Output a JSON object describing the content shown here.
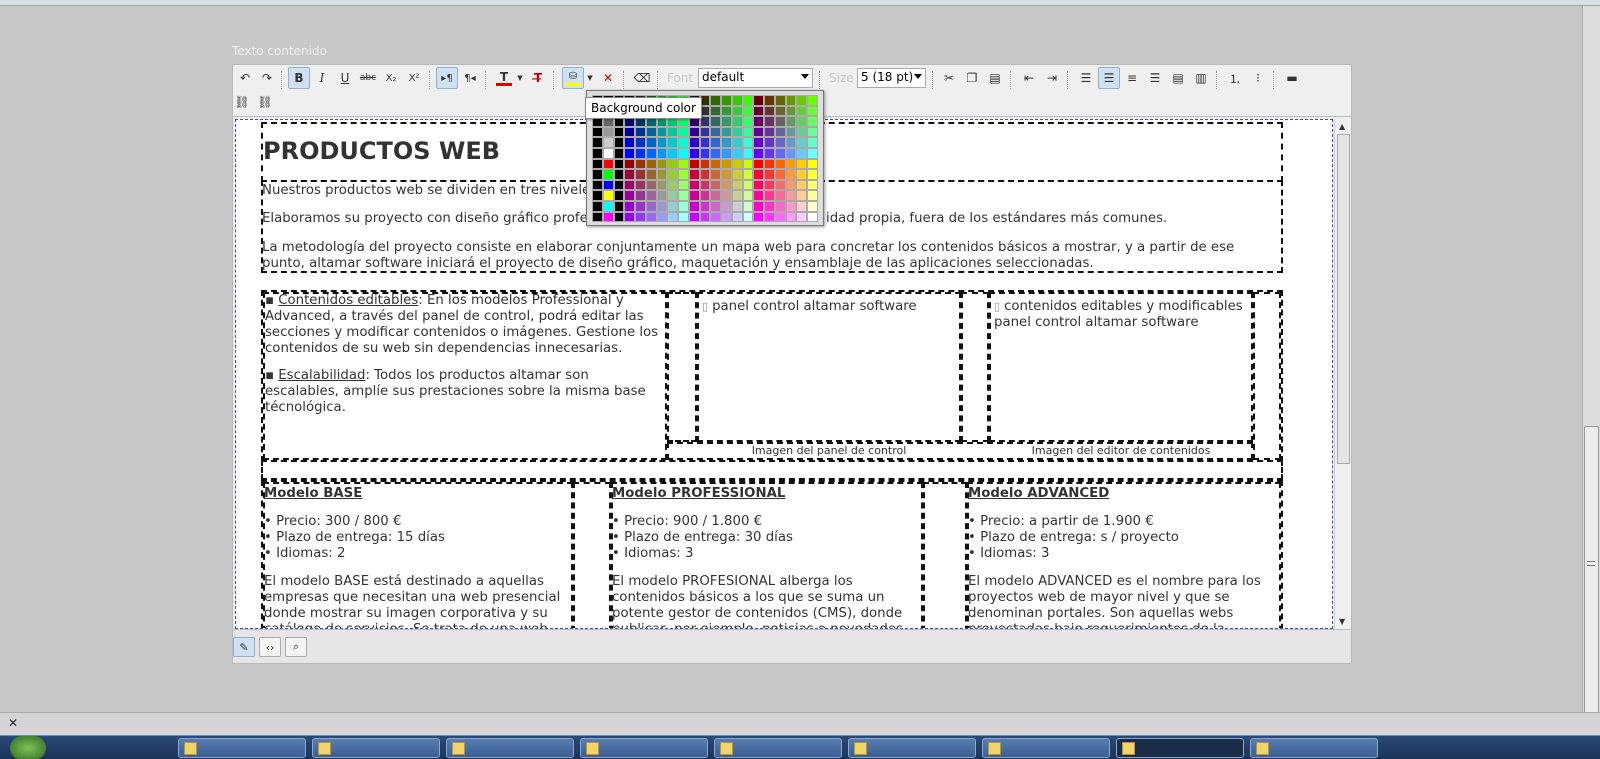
{
  "section_label": "Texto contenido",
  "toolbar": {
    "font_label": "Font",
    "font_value": "default",
    "size_label": "Size",
    "size_value": "5 (18 pt)",
    "bold": "B",
    "italic": "I",
    "underline": "U",
    "strike": "abc",
    "subscript": "X₂",
    "superscript": "X²",
    "text_color_letter": "T"
  },
  "tooltip": "Background color",
  "content": {
    "title": "PRODUCTOS WEB",
    "p1": "Nuestros productos web se dividen en tres niveles",
    "p2_a": "Elaboramos su proyecto con diseño gráfico profesi",
    "p2_b": "idad propia, fuera de los estándares más comunes.",
    "p3": "La metodología del proyecto consiste en elaborar conjuntamente un mapa web para concretar los contenidos básicos a mostrar, y a partir de ese punto, altamar software iniciará el proyecto de diseño gráfico, maquetación y ensamblaje de las aplicaciones seleccionadas.",
    "bullet1_link": "Contenidos editables",
    "bullet1_text": ": En los modelos Professional y Advanced, a través del panel de control, podrá editar las secciones y modificar contenidos o imágenes. Gestione los contenidos de su web sin dependencias innecesarias.",
    "bullet2_link": "Escalabilidad",
    "bullet2_text": ": Todos los productos altamar son escalables, amplíe sus prestaciones sobre la misma base técnológica.",
    "img1_alt": "panel control altamar software",
    "img2_alt": "contenidos editables y modificables panel control altamar software",
    "caption1": "Imagen del panel de control",
    "caption2": "Imagen del editor de contenidos",
    "models": [
      {
        "title": "Modelo BASE",
        "price": "• Precio: 300 / 800 €",
        "delivery": "• Plazo de entrega: 15 días",
        "languages": "• Idiomas: 2",
        "desc": "El modelo BASE está destinado a aquellas empresas que necesitan una web presencial donde mostrar su imagen corporativa y su catálogo de servicios. Se trata de una web"
      },
      {
        "title": "Modelo PROFESSIONAL",
        "price": "• Precio: 900 / 1.800 €",
        "delivery": "• Plazo de entrega: 30 días",
        "languages": "• Idiomas: 3",
        "desc": "El modelo PROFESIONAL alberga los contenidos básicos a los que se suma un potente gestor de contenidos (CMS), donde publicar, por ejemplo, noticias o novedades comerciales. El"
      },
      {
        "title": "Modelo ADVANCED",
        "price": "• Precio: a partir de 1.900 €",
        "delivery": "• Plazo de entrega: s / proyecto",
        "languages": "• Idiomas: 3",
        "desc": "El modelo ADVANCED es el nombre para los proyectos web de mayor nivel y que se denominan portales. Son aquellas webs proyectadas bajo requerimientos de la empresa"
      }
    ]
  },
  "colors": {
    "accent_blue": "#3050c8",
    "text_color_bar": "#e00000",
    "bg_color_bar": "#ffff00"
  },
  "closebar_x": "✕"
}
